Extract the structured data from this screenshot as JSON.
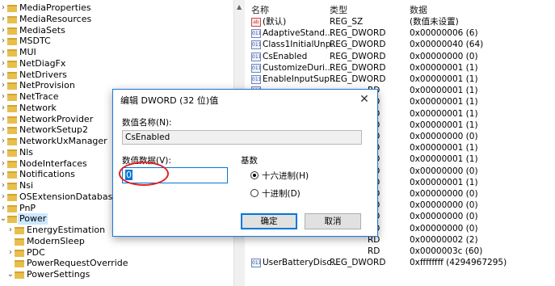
{
  "tree": {
    "items": [
      {
        "label": "MediaProperties",
        "expander": "›",
        "selected": false
      },
      {
        "label": "MediaResources",
        "expander": "›",
        "selected": false
      },
      {
        "label": "MediaSets",
        "expander": "›",
        "selected": false
      },
      {
        "label": "MSDTC",
        "expander": "›",
        "selected": false
      },
      {
        "label": "MUI",
        "expander": "›",
        "selected": false
      },
      {
        "label": "NetDiagFx",
        "expander": "›",
        "selected": false
      },
      {
        "label": "NetDrivers",
        "expander": "›",
        "selected": false
      },
      {
        "label": "NetProvision",
        "expander": "›",
        "selected": false
      },
      {
        "label": "NetTrace",
        "expander": "›",
        "selected": false
      },
      {
        "label": "Network",
        "expander": "›",
        "selected": false
      },
      {
        "label": "NetworkProvider",
        "expander": "›",
        "selected": false
      },
      {
        "label": "NetworkSetup2",
        "expander": "›",
        "selected": false
      },
      {
        "label": "NetworkUxManager",
        "expander": "›",
        "selected": false
      },
      {
        "label": "Nls",
        "expander": "›",
        "selected": false
      },
      {
        "label": "NodeInterfaces",
        "expander": "›",
        "selected": false
      },
      {
        "label": "Notifications",
        "expander": "›",
        "selected": false
      },
      {
        "label": "Nsi",
        "expander": "›",
        "selected": false
      },
      {
        "label": "OSExtensionDatabase",
        "expander": "›",
        "selected": false
      },
      {
        "label": "PnP",
        "expander": "›",
        "selected": false
      },
      {
        "label": "Power",
        "expander": "⌄",
        "selected": true
      },
      {
        "label": "EnergyEstimation",
        "expander": "›",
        "selected": false
      },
      {
        "label": "ModernSleep",
        "expander": "",
        "selected": false
      },
      {
        "label": "PDC",
        "expander": "›",
        "selected": false
      },
      {
        "label": "PowerRequestOverride",
        "expander": "",
        "selected": false
      },
      {
        "label": "PowerSettings",
        "expander": "⌄",
        "selected": false
      }
    ]
  },
  "values": {
    "headers": {
      "name": "名称",
      "type": "类型",
      "data": "数据"
    },
    "rows": [
      {
        "icon": "ab",
        "name": "(默认)",
        "type": "REG_SZ",
        "data": "(数值未设置)"
      },
      {
        "icon": "011",
        "name": "AdaptiveStand...",
        "type": "REG_DWORD",
        "data": "0x00000006 (6)"
      },
      {
        "icon": "011",
        "name": "Class1InitialUnp...",
        "type": "REG_DWORD",
        "data": "0x00000040 (64)"
      },
      {
        "icon": "011",
        "name": "CsEnabled",
        "type": "REG_DWORD",
        "data": "0x00000000 (0)"
      },
      {
        "icon": "011",
        "name": "CustomizeDuri...",
        "type": "REG_DWORD",
        "data": "0x00000001 (1)"
      },
      {
        "icon": "011",
        "name": "EnableInputSup...",
        "type": "REG_DWORD",
        "data": "0x00000001 (1)"
      },
      {
        "icon": "011",
        "name": "",
        "type": "RD",
        "data": "0x00000001 (1)"
      },
      {
        "icon": "",
        "name": "",
        "type": "RD",
        "data": "0x00000001 (1)"
      },
      {
        "icon": "",
        "name": "",
        "type": "RD",
        "data": "0x00000001 (1)"
      },
      {
        "icon": "",
        "name": "",
        "type": "RD",
        "data": "0x00000001 (1)"
      },
      {
        "icon": "",
        "name": "",
        "type": "RD",
        "data": "0x00000000 (0)"
      },
      {
        "icon": "",
        "name": "",
        "type": "RD",
        "data": "0x00000001 (1)"
      },
      {
        "icon": "",
        "name": "",
        "type": "RD",
        "data": "0x00000001 (1)"
      },
      {
        "icon": "",
        "name": "",
        "type": "RD",
        "data": "0x00000000 (0)"
      },
      {
        "icon": "",
        "name": "",
        "type": "RD",
        "data": "0x00000001 (1)"
      },
      {
        "icon": "",
        "name": "",
        "type": "RD",
        "data": "0x00000000 (0)"
      },
      {
        "icon": "",
        "name": "",
        "type": "RD",
        "data": "0x00000000 (0)"
      },
      {
        "icon": "",
        "name": "",
        "type": "RD",
        "data": "0x00000000 (0)"
      },
      {
        "icon": "",
        "name": "",
        "type": "RD",
        "data": "0x00000000 (0)"
      },
      {
        "icon": "",
        "name": "",
        "type": "RD",
        "data": "0x00000002 (2)"
      },
      {
        "icon": "",
        "name": "",
        "type": "RD",
        "data": "0x0000003c (60)"
      },
      {
        "icon": "011",
        "name": "UserBatteryDisc...",
        "type": "REG_DWORD",
        "data": "0xffffffff (4294967295)"
      }
    ]
  },
  "dialog": {
    "title": "编辑 DWORD (32 位)值",
    "close_glyph": "✕",
    "value_name_label": "数值名称(N):",
    "value_name": "CsEnabled",
    "value_data_label": "数值数据(V):",
    "value_data": "0",
    "base_label": "基数",
    "hex_label": "十六进制(H)",
    "dec_label": "十进制(D)",
    "base_selected": "hex",
    "ok_label": "确定",
    "cancel_label": "取消"
  },
  "colors": {
    "accent": "#0078d7",
    "highlight_circle": "#e52020",
    "folder": "#e8bf4d",
    "selection": "#cce8ff"
  }
}
